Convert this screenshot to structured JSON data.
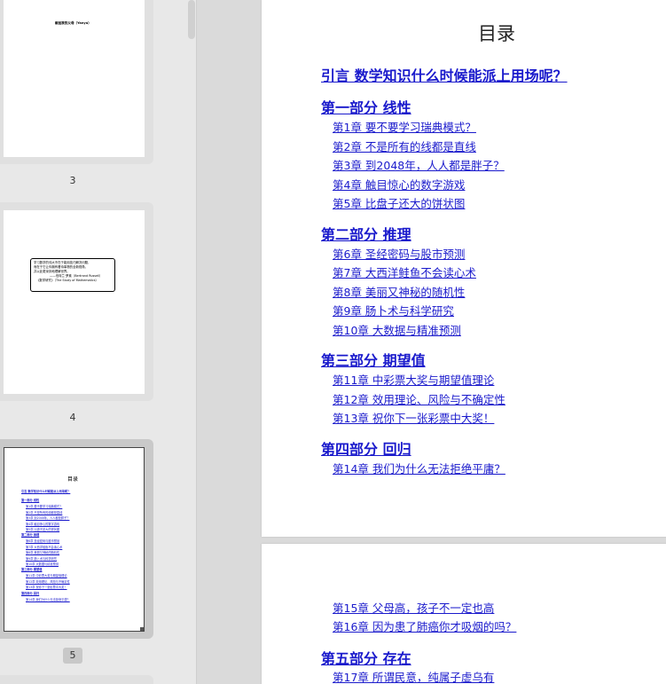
{
  "sidebar": {
    "thumbnails": [
      {
        "page_label": "3",
        "mini_text": "献给我的父母（Yanyu）"
      },
      {
        "page_label": "4",
        "mini_quote": [
          "学习数学的伟大不在于能用技巧解决问题，",
          "而在于它让你拥有看待事物的全新视角，",
          "并以此更深刻地理解世界。"
        ],
        "mini_attrib": [
          "——伯特兰·罗素（Bertrand Russell）",
          "《数学研究》（The Study of Mathematics）"
        ]
      },
      {
        "page_label": "5",
        "active": true,
        "mini_title": "目录",
        "mini_lines": [
          {
            "t": "引言 数学知识什么时候能派上用场呢？",
            "k": "intro"
          },
          {
            "t": "第一部分 线性",
            "k": "part"
          },
          {
            "t": "第1章 要不要学习瑞典模式？",
            "k": "ch"
          },
          {
            "t": "第2章 不是所有的线都是直线",
            "k": "ch"
          },
          {
            "t": "第3章 到2048年，人人都是胖子？",
            "k": "ch"
          },
          {
            "t": "第4章 触目惊心的数字游戏",
            "k": "ch"
          },
          {
            "t": "第5章 比盘子还大的饼状图",
            "k": "ch"
          },
          {
            "t": "第二部分 推理",
            "k": "part"
          },
          {
            "t": "第6章 圣经密码与股市预测",
            "k": "ch"
          },
          {
            "t": "第7章 大西洋鲑鱼不会读心术",
            "k": "ch"
          },
          {
            "t": "第8章 美丽又神秘的随机性",
            "k": "ch"
          },
          {
            "t": "第9章 肠卜术与科学研究",
            "k": "ch"
          },
          {
            "t": "第10章 大数据与精准预测",
            "k": "ch"
          },
          {
            "t": "第三部分 期望值",
            "k": "part"
          },
          {
            "t": "第11章 中彩票大奖与期望值理论",
            "k": "ch"
          },
          {
            "t": "第12章 效用理论、风险与不确定性",
            "k": "ch"
          },
          {
            "t": "第13章 祝你下一张彩票中大奖！",
            "k": "ch"
          },
          {
            "t": "第四部分 回归",
            "k": "part"
          },
          {
            "t": "第14章 我们为什么无法拒绝平庸？",
            "k": "ch"
          }
        ]
      }
    ]
  },
  "toc": {
    "title": "目录",
    "intro": "引言 数学知识什么时候能派上用场呢？",
    "parts": [
      {
        "label": "第一部分 线性",
        "chapters": [
          "第1章 要不要学习瑞典模式？",
          "第2章 不是所有的线都是直线",
          "第3章 到2048年，人人都是胖子？",
          "第4章 触目惊心的数字游戏",
          "第5章 比盘子还大的饼状图"
        ]
      },
      {
        "label": "第二部分 推理",
        "chapters": [
          "第6章 圣经密码与股市预测",
          "第7章 大西洋鲑鱼不会读心术",
          "第8章 美丽又神秘的随机性",
          "第9章 肠卜术与科学研究",
          "第10章 大数据与精准预测"
        ]
      },
      {
        "label": "第三部分 期望值",
        "chapters": [
          "第11章 中彩票大奖与期望值理论",
          "第12章 效用理论、风险与不确定性",
          "第13章 祝你下一张彩票中大奖！"
        ]
      },
      {
        "label": "第四部分 回归",
        "chapters": [
          "第14章 我们为什么无法拒绝平庸？"
        ]
      }
    ],
    "page2": {
      "chapters_before": [
        "第15章 父母高，孩子不一定也高",
        "第16章 因为患了肺癌你才吸烟的吗？"
      ],
      "part": "第五部分 存在",
      "chapters_after": [
        "第17章 所谓民意，纯属子虚乌有"
      ]
    }
  },
  "colors": {
    "link": "#1a1acc",
    "sidebar_bg": "#e8e8e8",
    "doc_bg": "#dadada"
  }
}
